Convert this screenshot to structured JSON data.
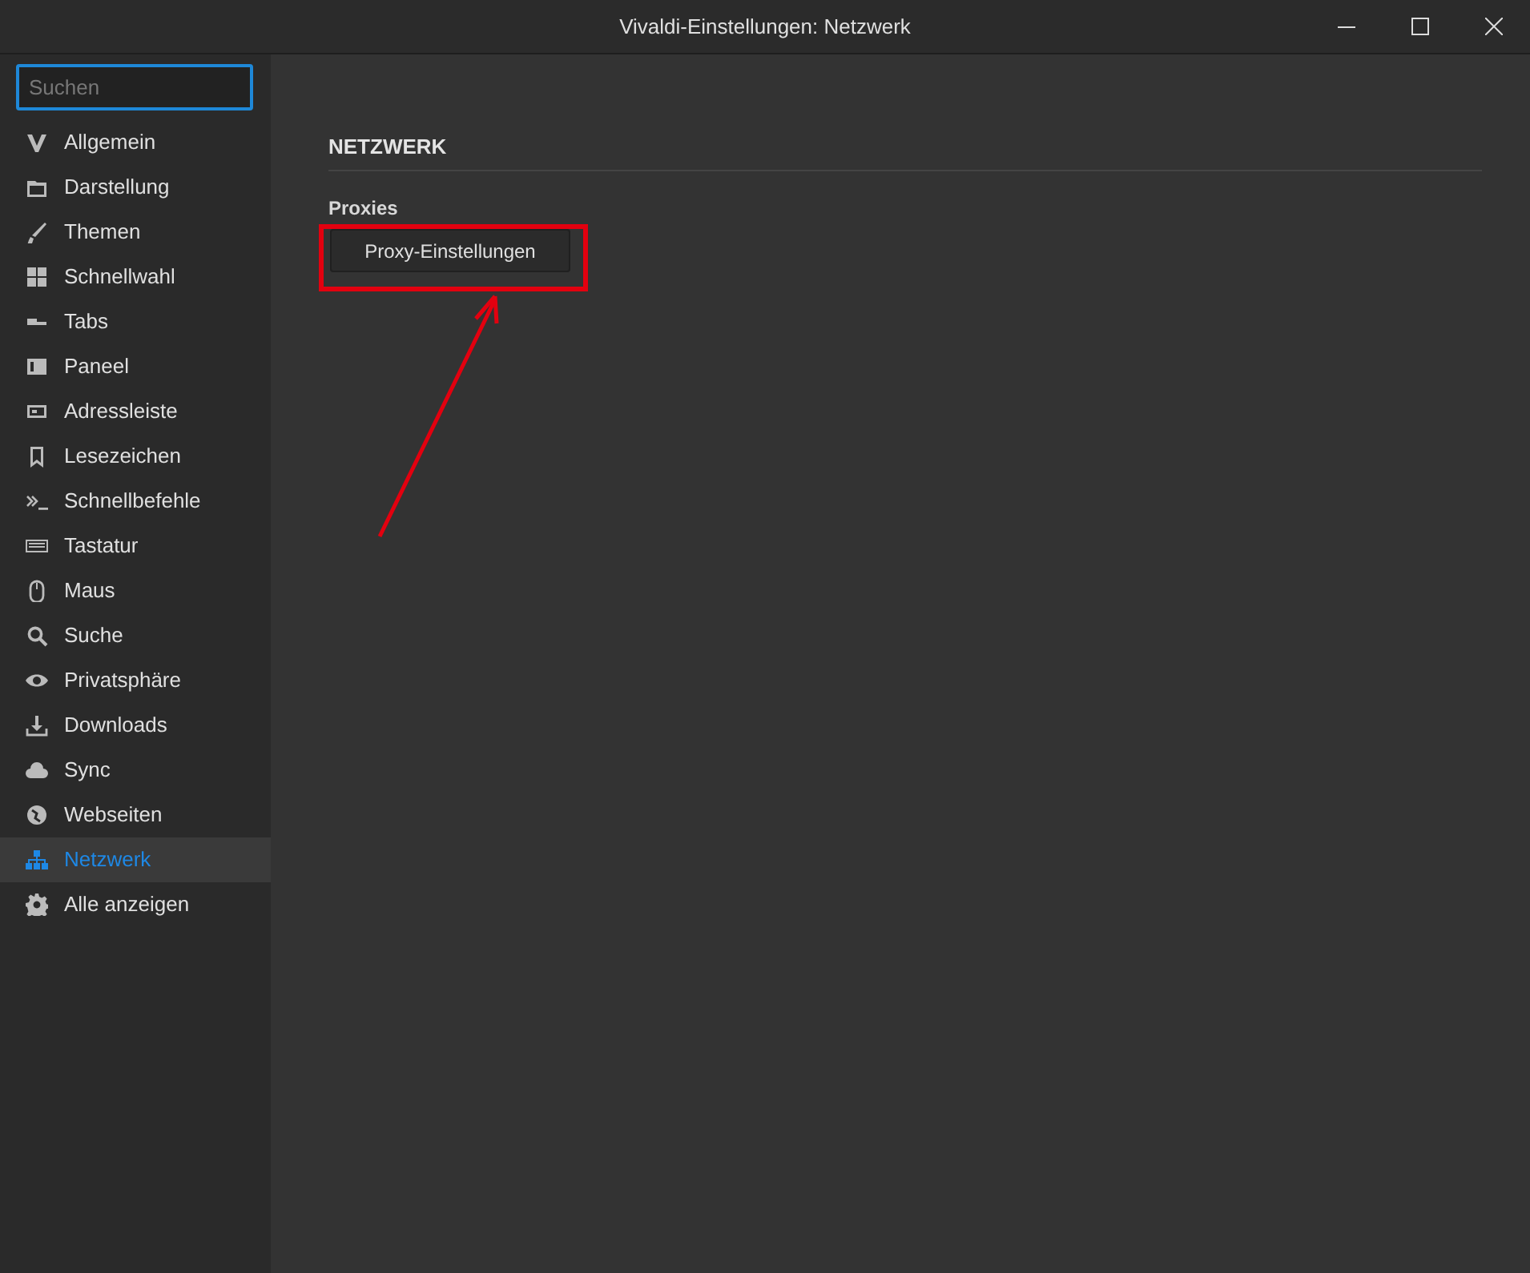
{
  "window": {
    "title": "Vivaldi-Einstellungen: Netzwerk"
  },
  "search": {
    "placeholder": "Suchen"
  },
  "sidebar": {
    "items": [
      {
        "label": "Allgemein",
        "selected": false
      },
      {
        "label": "Darstellung",
        "selected": false
      },
      {
        "label": "Themen",
        "selected": false
      },
      {
        "label": "Schnellwahl",
        "selected": false
      },
      {
        "label": "Tabs",
        "selected": false
      },
      {
        "label": "Paneel",
        "selected": false
      },
      {
        "label": "Adressleiste",
        "selected": false
      },
      {
        "label": "Lesezeichen",
        "selected": false
      },
      {
        "label": "Schnellbefehle",
        "selected": false
      },
      {
        "label": "Tastatur",
        "selected": false
      },
      {
        "label": "Maus",
        "selected": false
      },
      {
        "label": "Suche",
        "selected": false
      },
      {
        "label": "Privatsphäre",
        "selected": false
      },
      {
        "label": "Downloads",
        "selected": false
      },
      {
        "label": "Sync",
        "selected": false
      },
      {
        "label": "Webseiten",
        "selected": false
      },
      {
        "label": "Netzwerk",
        "selected": true
      },
      {
        "label": "Alle anzeigen",
        "selected": false
      }
    ]
  },
  "content": {
    "heading": "NETZWERK",
    "section": "Proxies",
    "button": "Proxy-Einstellungen"
  }
}
